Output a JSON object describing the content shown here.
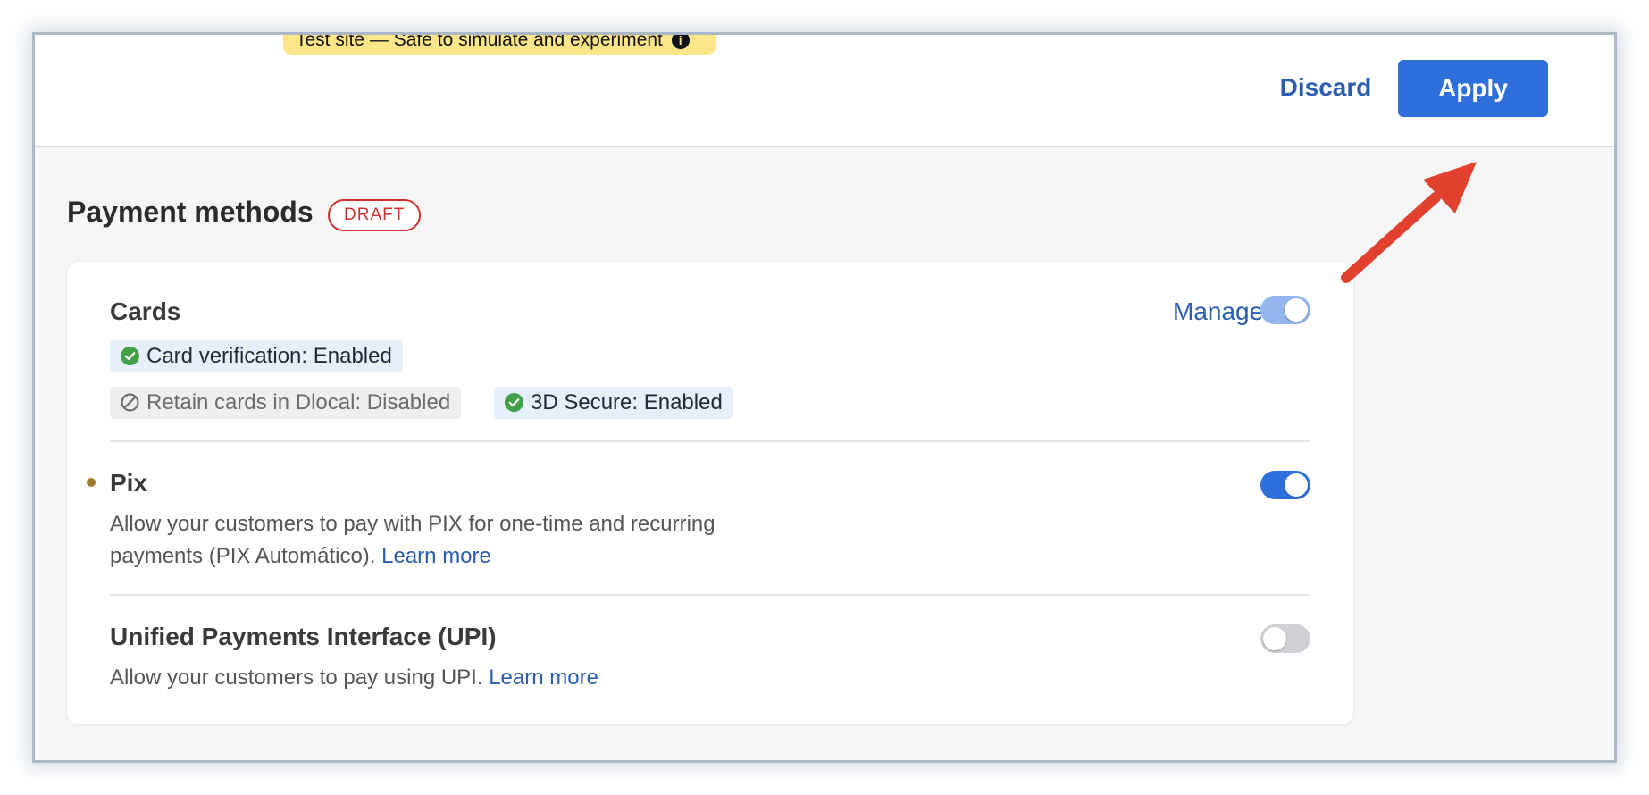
{
  "banner": {
    "text": "Test site — Safe to simulate and experiment",
    "icon": "info-icon"
  },
  "toolbar": {
    "discard_label": "Discard",
    "apply_label": "Apply"
  },
  "section": {
    "title": "Payment methods",
    "badge": "DRAFT"
  },
  "methods": {
    "cards": {
      "title": "Cards",
      "manage_label": "Manage",
      "toggle_on": true,
      "chips": [
        {
          "label": "Card verification: Enabled",
          "icon": "check-circle-icon",
          "status": "enabled"
        },
        {
          "label": "Retain cards in Dlocal: Disabled",
          "icon": "disabled-icon",
          "status": "disabled"
        },
        {
          "label": "3D Secure: Enabled",
          "icon": "check-circle-icon",
          "status": "enabled"
        }
      ]
    },
    "pix": {
      "title": "Pix",
      "description": "Allow your customers to pay with PIX for one-time and recurring payments (PIX Automático).",
      "link": "Learn more",
      "toggle_on": true
    },
    "upi": {
      "title": "Unified Payments Interface (UPI)",
      "description": "Allow your customers to pay using UPI.",
      "link": "Learn more",
      "toggle_on": false
    }
  },
  "colors": {
    "primary": "#2f6fdc",
    "link": "#2a5db0",
    "draft": "#d32f2f",
    "banner": "#fde68a",
    "success": "#43a047",
    "annotation_arrow": "#e2412f"
  }
}
